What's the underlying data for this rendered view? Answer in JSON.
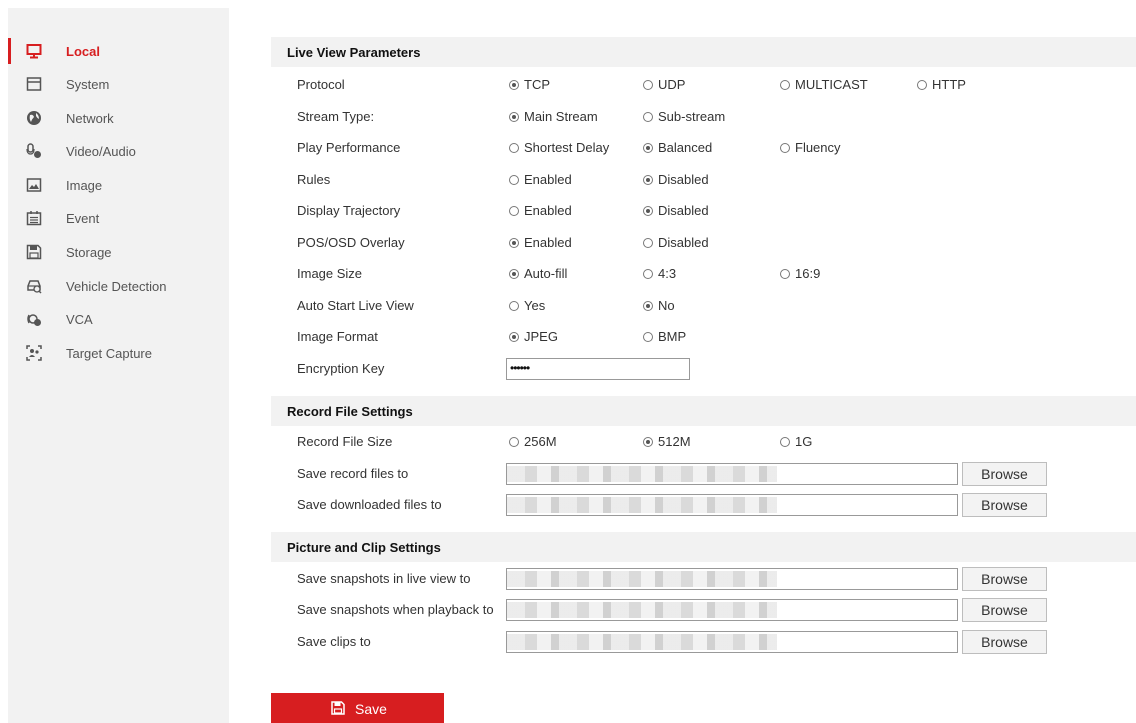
{
  "sidebar": {
    "items": [
      {
        "label": "Local",
        "icon": "monitor-icon",
        "active": true
      },
      {
        "label": "System",
        "icon": "system-icon"
      },
      {
        "label": "Network",
        "icon": "globe-icon"
      },
      {
        "label": "Video/Audio",
        "icon": "video-audio-icon"
      },
      {
        "label": "Image",
        "icon": "image-icon"
      },
      {
        "label": "Event",
        "icon": "calendar-icon"
      },
      {
        "label": "Storage",
        "icon": "storage-icon"
      },
      {
        "label": "Vehicle Detection",
        "icon": "vehicle-icon"
      },
      {
        "label": "VCA",
        "icon": "vca-icon"
      },
      {
        "label": "Target Capture",
        "icon": "target-capture-icon"
      }
    ]
  },
  "live_view": {
    "title": "Live View Parameters",
    "rows": [
      {
        "label": "Protocol",
        "options": [
          "TCP",
          "UDP",
          "MULTICAST",
          "HTTP"
        ],
        "selected": 0
      },
      {
        "label": "Stream Type:",
        "options": [
          "Main Stream",
          "Sub-stream"
        ],
        "selected": 0
      },
      {
        "label": "Play Performance",
        "options": [
          "Shortest Delay",
          "Balanced",
          "Fluency"
        ],
        "selected": 1
      },
      {
        "label": "Rules",
        "options": [
          "Enabled",
          "Disabled"
        ],
        "selected": 1
      },
      {
        "label": "Display Trajectory",
        "options": [
          "Enabled",
          "Disabled"
        ],
        "selected": 1
      },
      {
        "label": "POS/OSD Overlay",
        "options": [
          "Enabled",
          "Disabled"
        ],
        "selected": 0
      },
      {
        "label": "Image Size",
        "options": [
          "Auto-fill",
          "4:3",
          "16:9"
        ],
        "selected": 0
      },
      {
        "label": "Auto Start Live View",
        "options": [
          "Yes",
          "No"
        ],
        "selected": 1
      },
      {
        "label": "Image Format",
        "options": [
          "JPEG",
          "BMP"
        ],
        "selected": 0
      }
    ],
    "encryption_label": "Encryption Key",
    "encryption_value": "••••••"
  },
  "record_file": {
    "title": "Record File Settings",
    "size_label": "Record File Size",
    "size_options": [
      "256M",
      "512M",
      "1G"
    ],
    "size_selected": 1,
    "save_record_label": "Save record files to",
    "save_downloaded_label": "Save downloaded files to"
  },
  "picture_clip": {
    "title": "Picture and Clip Settings",
    "snap_live_label": "Save snapshots in live view to",
    "snap_playback_label": "Save snapshots when playback to",
    "clips_label": "Save clips to"
  },
  "browse_label": "Browse",
  "save_label": "Save",
  "colors": {
    "accent": "#d71e20",
    "sidebar_bg": "#f2f2f2"
  }
}
